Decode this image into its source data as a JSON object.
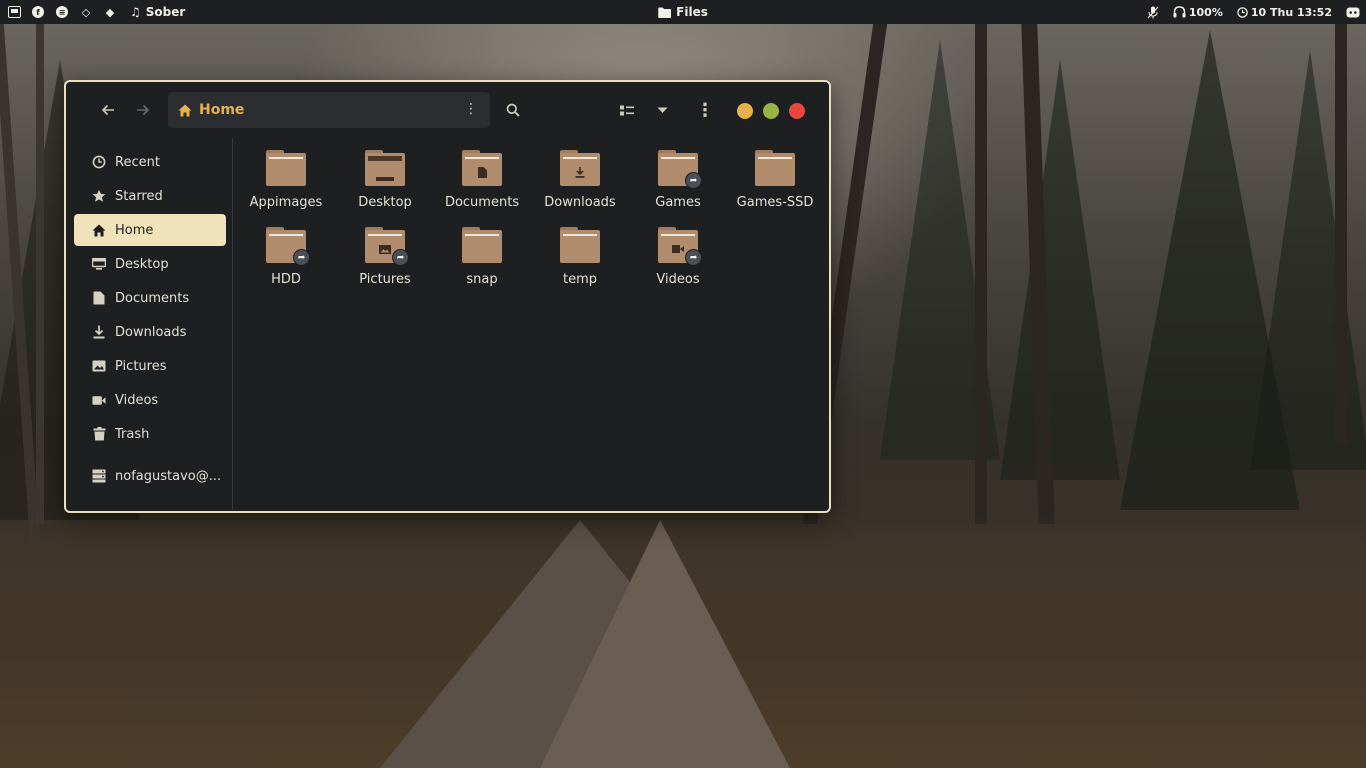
{
  "topbar": {
    "app_name": "Sober",
    "window_title": "Files",
    "battery": "100%",
    "clock": "10 Thu 13:52",
    "icons": [
      "app-launcher-icon",
      "firefox-icon",
      "spotify-icon",
      "diamond-outline-icon",
      "diamond-icon",
      "music-note-icon",
      "folder-icon",
      "mic-muted-icon",
      "headphones-icon",
      "clock-icon",
      "discord-icon"
    ]
  },
  "headerbar": {
    "path_label": "Home",
    "icons": [
      "back-arrow-icon",
      "forward-arrow-icon",
      "home-icon",
      "kebab-menu-icon",
      "search-icon",
      "list-view-icon",
      "chevron-down-icon",
      "more-vertical-icon"
    ],
    "window_controls": {
      "minimize": "#e8b04c",
      "maximize": "#98b444",
      "close": "#e8473e"
    }
  },
  "sidebar": {
    "items": [
      {
        "label": "Recent",
        "icon": "clock-icon"
      },
      {
        "label": "Starred",
        "icon": "star-icon"
      },
      {
        "label": "Home",
        "icon": "home-icon",
        "active": true
      },
      {
        "label": "Desktop",
        "icon": "desktop-icon"
      },
      {
        "label": "Documents",
        "icon": "document-icon"
      },
      {
        "label": "Downloads",
        "icon": "download-icon"
      },
      {
        "label": "Pictures",
        "icon": "picture-icon"
      },
      {
        "label": "Videos",
        "icon": "video-icon"
      },
      {
        "label": "Trash",
        "icon": "trash-icon"
      },
      {
        "label": "nofagustavo@...",
        "icon": "server-icon"
      }
    ]
  },
  "files": [
    {
      "name": "Appimages"
    },
    {
      "name": "Desktop"
    },
    {
      "name": "Documents"
    },
    {
      "name": "Downloads"
    },
    {
      "name": "Games"
    },
    {
      "name": "Games-SSD"
    },
    {
      "name": "HDD"
    },
    {
      "name": "Pictures"
    },
    {
      "name": "snap"
    },
    {
      "name": "temp"
    },
    {
      "name": "Videos"
    }
  ],
  "colors": {
    "accent": "#e8b04c",
    "sidebar_active": "#f0e3b9",
    "window_bg": "#1d1f21",
    "folder": "#b08b6c"
  }
}
